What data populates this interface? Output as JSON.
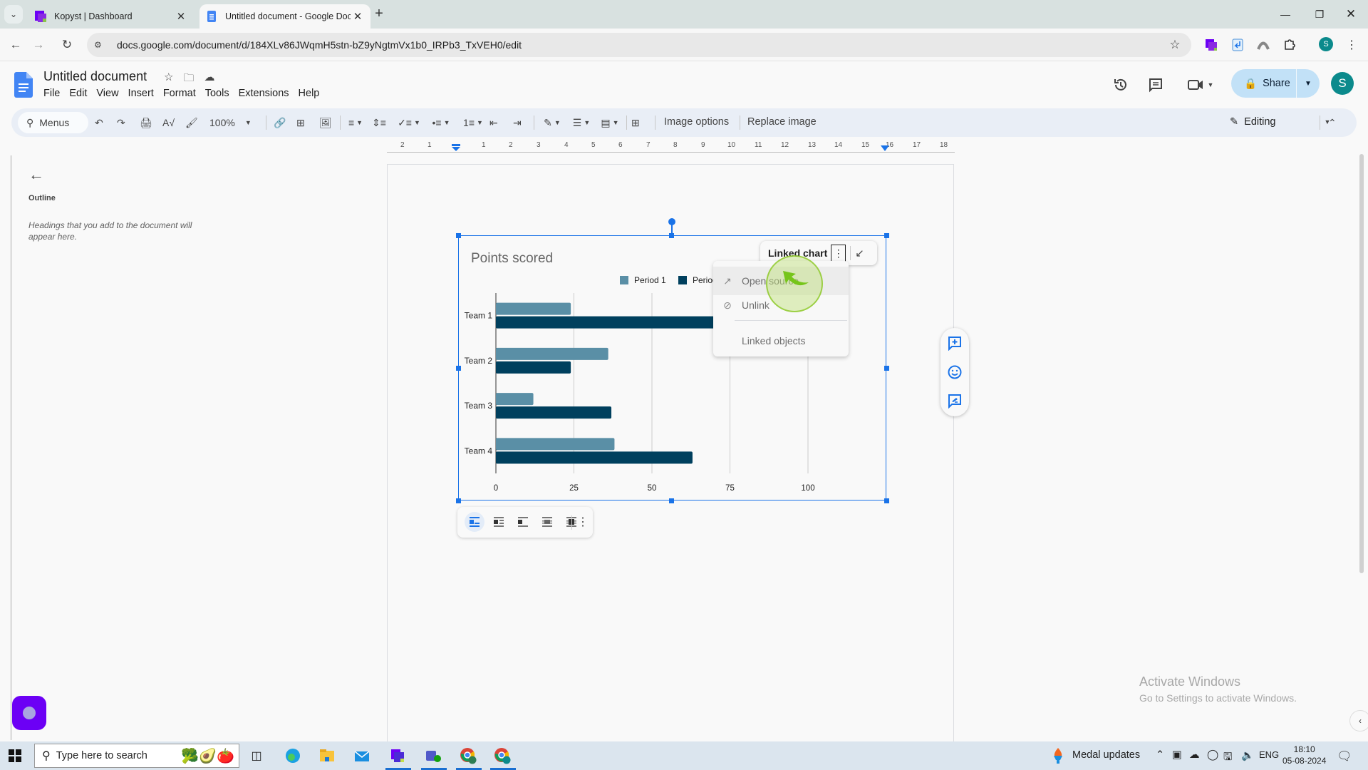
{
  "browser": {
    "tabs": [
      {
        "title": "Kopyst | Dashboard",
        "active": false
      },
      {
        "title": "Untitled document - Google Docs",
        "active": true
      }
    ],
    "url": "docs.google.com/document/d/184XLv86JWqmH5stn-bZ9yNgtmVx1b0_IRPb3_TxVEH0/edit",
    "profile_initial": "S"
  },
  "docs": {
    "title": "Untitled document",
    "menus": [
      "File",
      "Edit",
      "View",
      "Insert",
      "Format",
      "Tools",
      "Extensions",
      "Help"
    ],
    "share_label": "Share",
    "avatar_initial": "S",
    "toolbar": {
      "menus_search": "Menus",
      "zoom": "100%",
      "image_options": "Image options",
      "replace_image": "Replace image",
      "mode": "Editing"
    },
    "ruler_numbers": [
      "2",
      "1",
      "1",
      "2",
      "3",
      "4",
      "5",
      "6",
      "7",
      "8",
      "9",
      "10",
      "11",
      "12",
      "13",
      "14",
      "15",
      "16",
      "17",
      "18"
    ],
    "outline": {
      "title": "Outline",
      "hint": "Headings that you add to the document will appear here."
    },
    "linked_chart": {
      "label": "Linked chart",
      "menu": [
        {
          "label": "Open source",
          "icon": "open-in-new-icon",
          "highlighted": true
        },
        {
          "label": "Unlink",
          "icon": "link-off-icon",
          "highlighted": false
        },
        {
          "label": "Linked objects",
          "icon": "",
          "highlighted": false
        }
      ]
    }
  },
  "chart_data": {
    "type": "bar",
    "orientation": "horizontal",
    "title": "Points scored",
    "categories": [
      "Team 1",
      "Team 2",
      "Team 3",
      "Team 4"
    ],
    "series": [
      {
        "name": "Period 1",
        "color": "#5a8fa6",
        "values": [
          24,
          36,
          12,
          38
        ]
      },
      {
        "name": "Period 2",
        "color": "#00405e",
        "values": [
          71,
          24,
          37,
          63
        ]
      }
    ],
    "xlabel": "",
    "ylabel": "",
    "xlim": [
      0,
      100
    ],
    "xticks": [
      "0",
      "25",
      "50",
      "75",
      "100"
    ],
    "grid": true,
    "legend": "top"
  },
  "windows": {
    "activate_title": "Activate Windows",
    "activate_sub": "Go to Settings to activate Windows.",
    "search_placeholder": "Type here to search",
    "tray_app": "Medal updates",
    "lang": "ENG",
    "time": "18:10",
    "date": "05-08-2024"
  }
}
